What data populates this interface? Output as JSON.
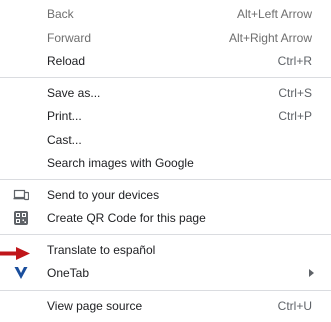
{
  "menu": {
    "back": {
      "label": "Back",
      "shortcut": "Alt+Left Arrow"
    },
    "forward": {
      "label": "Forward",
      "shortcut": "Alt+Right Arrow"
    },
    "reload": {
      "label": "Reload",
      "shortcut": "Ctrl+R"
    },
    "save_as": {
      "label": "Save as...",
      "shortcut": "Ctrl+S"
    },
    "print": {
      "label": "Print...",
      "shortcut": "Ctrl+P"
    },
    "cast": {
      "label": "Cast..."
    },
    "search_images": {
      "label": "Search images with Google"
    },
    "send_to_devices": {
      "label": "Send to your devices",
      "icon": "send-to-devices-icon"
    },
    "qr_code": {
      "label": "Create QR Code for this page",
      "icon": "qr-code-icon"
    },
    "translate": {
      "label": "Translate to español"
    },
    "onetab": {
      "label": "OneTab",
      "icon": "onetab-icon",
      "has_submenu": true
    },
    "view_source": {
      "label": "View page source",
      "shortcut": "Ctrl+U"
    }
  },
  "colors": {
    "background": "#ffffff",
    "text": "#202124",
    "shortcut": "#5f6368",
    "separator": "#dadce0",
    "annotation_arrow": "#c0161a",
    "onetab_brand": "#1a4e9c"
  },
  "annotation": {
    "icon": "red-pointer-arrow-icon"
  }
}
